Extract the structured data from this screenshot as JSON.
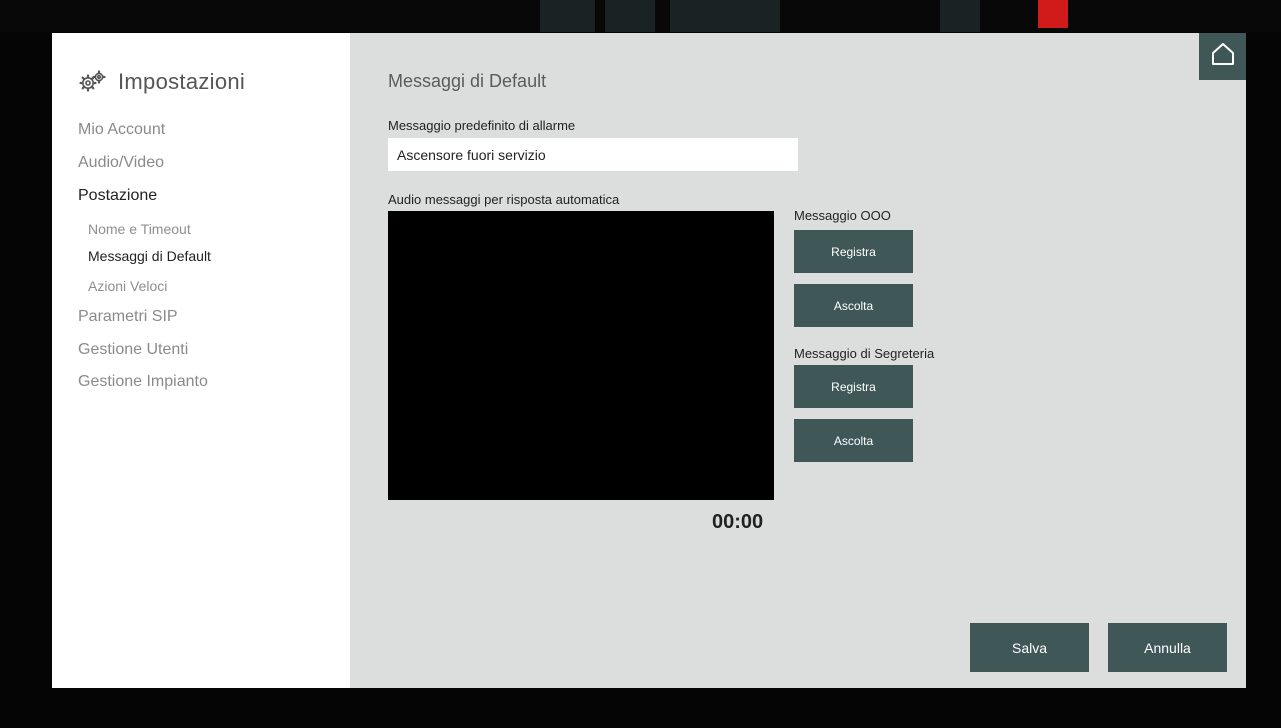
{
  "colors": {
    "accent": "#3f5757",
    "sidebar_bg": "#ffffff",
    "content_bg": "#dcdedd",
    "backdrop": "#050505"
  },
  "sidebar": {
    "title": "Impostazioni",
    "title_icon": "gears-icon",
    "items": [
      {
        "label": "Mio Account",
        "active": false
      },
      {
        "label": "Audio/Video",
        "active": false
      },
      {
        "label": "Postazione",
        "active": true
      },
      {
        "label": "Parametri SIP",
        "active": false
      },
      {
        "label": "Gestione Utenti",
        "active": false
      },
      {
        "label": "Gestione Impianto",
        "active": false
      }
    ],
    "subitems": [
      {
        "label": "Nome e Timeout",
        "active": false
      },
      {
        "label": "Messaggi di Default",
        "active": true
      },
      {
        "label": "Azioni Veloci",
        "active": false
      }
    ]
  },
  "main": {
    "section_title": "Messaggi di Default",
    "alarm_message": {
      "label": "Messaggio predefinito di allarme",
      "value": "Ascensore fuori servizio"
    },
    "audio": {
      "label": "Audio messaggi per risposta automatica",
      "timer": "00:00"
    },
    "ooo": {
      "label": "Messaggio OOO",
      "record_label": "Registra",
      "listen_label": "Ascolta"
    },
    "voicemail": {
      "label": "Messaggio di Segreteria",
      "record_label": "Registra",
      "listen_label": "Ascolta"
    },
    "save_label": "Salva",
    "cancel_label": "Annulla"
  },
  "home_icon": "home-icon"
}
